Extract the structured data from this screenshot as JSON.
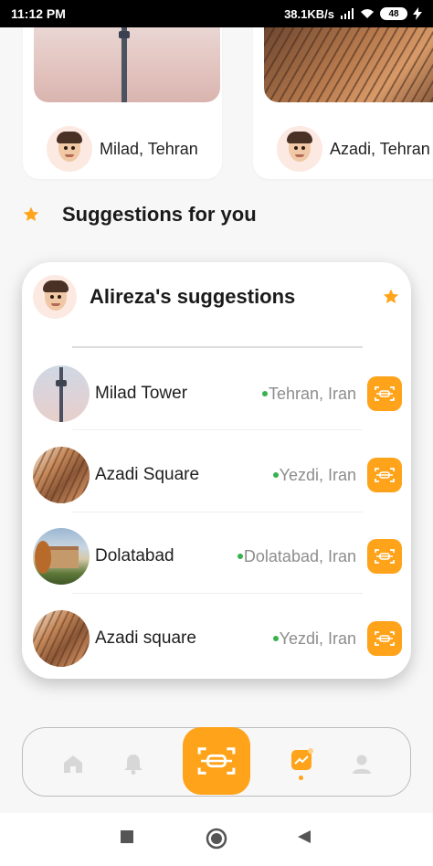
{
  "status_bar": {
    "time": "11:12 PM",
    "network_speed": "38.1KB/s",
    "battery": "48"
  },
  "top_cards": [
    {
      "user": "Milad, Tehran"
    },
    {
      "user": "Azadi, Tehran"
    }
  ],
  "section": {
    "title": "Suggestions for you",
    "icon": "star-icon"
  },
  "suggestions": {
    "title": "Alireza's suggestions",
    "items": [
      {
        "name": "Milad Tower",
        "location": "Tehran, Iran"
      },
      {
        "name": "Azadi Square",
        "location": "Yezdi, Iran"
      },
      {
        "name": "Dolatabad",
        "location": "Dolatabad, Iran"
      },
      {
        "name": "Azadi square",
        "location": "Yezdi, Iran"
      }
    ]
  },
  "bottom_nav": {
    "items": [
      "home-icon",
      "bell-icon",
      "scan-icon",
      "trending-icon",
      "profile-icon"
    ],
    "active": "trending-icon"
  },
  "colors": {
    "accent": "#ffa31a",
    "location_dot": "#37b24d",
    "inactive_icon": "#d7d7d7"
  }
}
